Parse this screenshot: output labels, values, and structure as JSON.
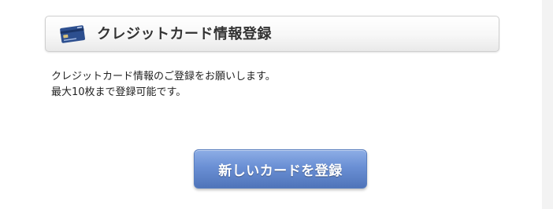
{
  "header": {
    "icon": "credit-card-icon",
    "title": "クレジットカード情報登録"
  },
  "description": {
    "line1": "クレジットカード情報のご登録をお願いします。",
    "line2": "最大10枚まで登録可能です。"
  },
  "actions": {
    "register_new_card_label": "新しいカードを登録"
  },
  "colors": {
    "button_blue": "#6a8fd4",
    "header_text": "#333333",
    "card_blue": "#2d4f8f"
  }
}
